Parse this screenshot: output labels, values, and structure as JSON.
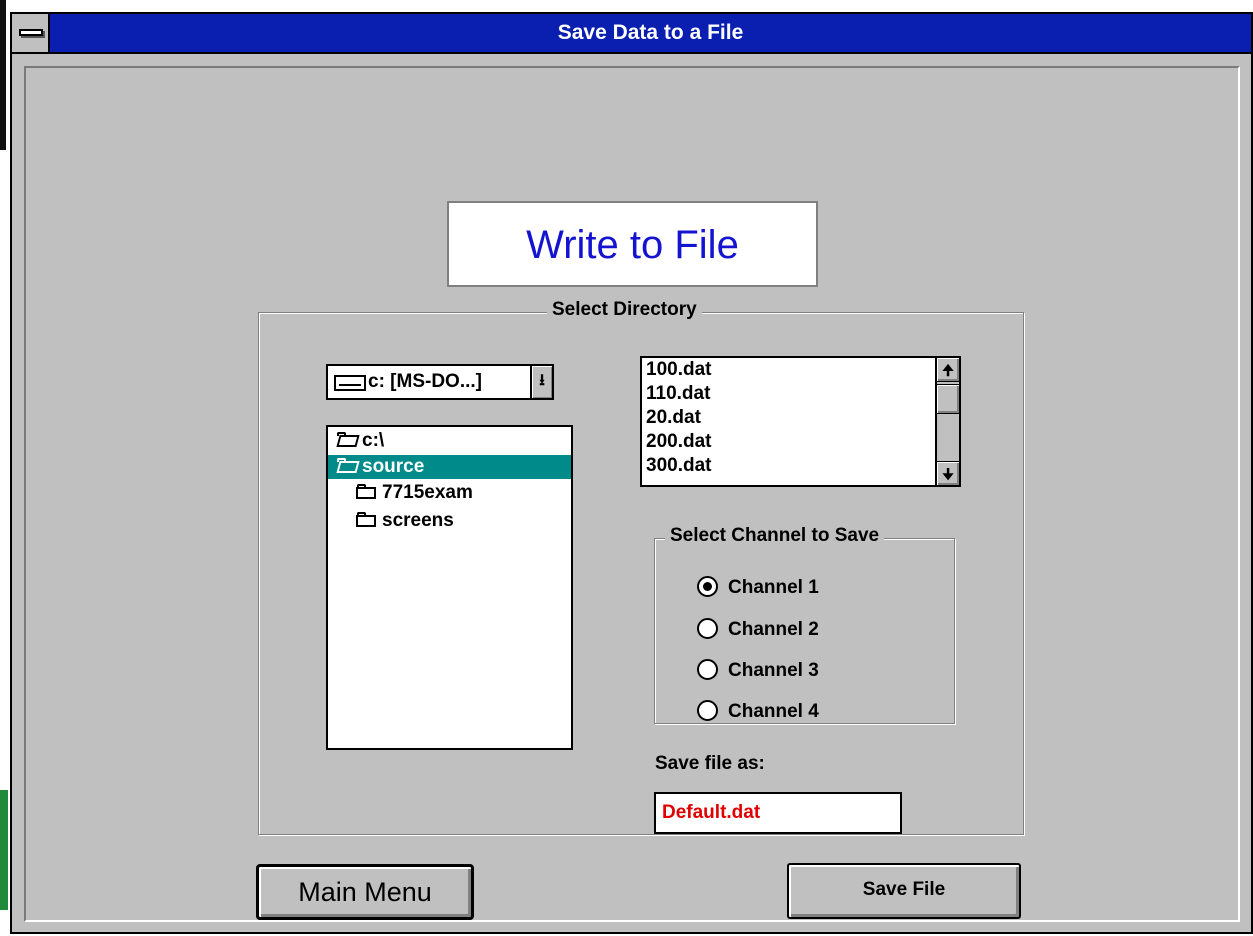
{
  "window": {
    "title": "Save Data to a File"
  },
  "heading": "Write to File",
  "directory_group": {
    "label": "Select Directory",
    "drive": "c: [MS-DO...]",
    "tree": [
      {
        "label": "c:\\",
        "icon": "open-folder-icon",
        "selected": false
      },
      {
        "label": "source",
        "icon": "open-folder-icon",
        "selected": true
      },
      {
        "label": "7715exam",
        "icon": "folder-icon",
        "selected": false
      },
      {
        "label": "screens",
        "icon": "folder-icon",
        "selected": false
      }
    ],
    "files": [
      "100.dat",
      "110.dat",
      "20.dat",
      "200.dat",
      "300.dat"
    ]
  },
  "channel_group": {
    "label": "Select Channel to Save",
    "options": [
      "Channel 1",
      "Channel 2",
      "Channel 3",
      "Channel 4"
    ],
    "selected": "Channel 1"
  },
  "save_as": {
    "label": "Save file as:",
    "value": "Default.dat",
    "value_color": "#e00000"
  },
  "buttons": {
    "main_menu": "Main Menu",
    "save_file": "Save File"
  },
  "colors": {
    "titlebar": "#0a1fb0",
    "selection": "#008a8a",
    "heading_text": "#1414d0"
  }
}
